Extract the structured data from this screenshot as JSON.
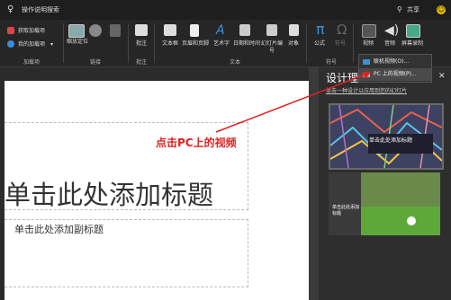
{
  "titlebar": {
    "tellme": "操作说明搜索",
    "share": "共享"
  },
  "ribbon": {
    "addins": {
      "get_addins": "获取加载项",
      "my_addins": "我的加载项",
      "group": "加载项"
    },
    "links": {
      "zoom": "缩放定位",
      "group": "链接"
    },
    "comments": {
      "comment": "批注",
      "group": "批注"
    },
    "text": {
      "textbox": "文本框",
      "header_footer": "页眉和页脚",
      "wordart": "艺术字",
      "datetime": "日期和时间",
      "slide_number": "幻灯片编号",
      "object": "对象",
      "group": "文本"
    },
    "symbols": {
      "equation": "公式",
      "symbol": "符号",
      "group": "符号"
    },
    "media": {
      "video": "视频",
      "audio": "音频",
      "screen_recording": "屏幕录制"
    }
  },
  "video_menu": {
    "online_video": "联机视频(O)...",
    "pc_video": "PC 上的视频(P)..."
  },
  "slide": {
    "title": "单击此处添加标题",
    "subtitle": "单击此处添加副标题"
  },
  "annotation": "点击PC上的视频",
  "designer": {
    "title": "设计理念",
    "link": "单击一种设计以应用到您的幻灯片",
    "design1_title": "单击此处添加标题",
    "design2_title": "单击此处添加标题"
  },
  "colors": {
    "annotation": "#e02020",
    "accent_blue": "#3b8fd9"
  }
}
